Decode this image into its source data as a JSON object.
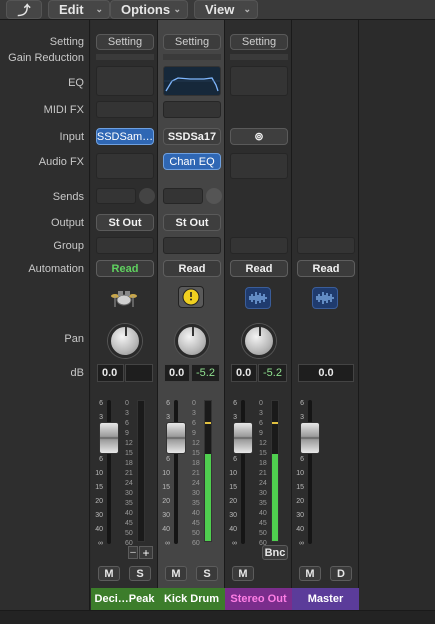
{
  "menubar": {
    "back_glyph": "⤴",
    "menus": [
      "Edit",
      "Options",
      "View"
    ]
  },
  "row_labels": {
    "setting": "Setting",
    "gain_reduction": "Gain Reduction",
    "eq": "EQ",
    "midi_fx": "MIDI FX",
    "input": "Input",
    "audio_fx": "Audio FX",
    "sends": "Sends",
    "output": "Output",
    "group": "Group",
    "automation": "Automation",
    "pan": "Pan",
    "db": "dB"
  },
  "strips": [
    {
      "setting": "Setting",
      "input": "SSDSam…",
      "audio_fx": "",
      "output": "St Out",
      "automation": "Read",
      "automation_color": "#5fd15f",
      "icon": "drum-kit-icon",
      "db_volume": "0.0",
      "db_peak": "",
      "mute": "M",
      "solo": "S",
      "extra": "+",
      "name": "Deci…Peak",
      "name_color": "#3c7d2b",
      "meter_level": 0
    },
    {
      "setting": "Setting",
      "input": "SSDSa17",
      "audio_fx": "Chan EQ",
      "output": "St Out",
      "automation": "Read",
      "automation_color": "#f0f0f0",
      "icon": "clock-icon",
      "db_volume": "0.0",
      "db_peak": "-5.2",
      "mute": "M",
      "solo": "S",
      "name": "Kick Drum",
      "name_color": "#3c7d2b",
      "meter_level": 0.62
    },
    {
      "setting": "Setting",
      "input": "⊚",
      "audio_fx": "",
      "output": "",
      "automation": "Read",
      "automation_color": "#f0f0f0",
      "icon": "waveform-icon",
      "db_volume": "0.0",
      "db_peak": "-5.2",
      "mute": "M",
      "bounce": "Bnc",
      "name": "Stereo Out",
      "name_color": "#7a2d8c",
      "meter_level": 0.62
    },
    {
      "automation": "Read",
      "automation_color": "#f0f0f0",
      "icon": "waveform-icon",
      "db_volume": "0.0",
      "mute": "M",
      "dim": "D",
      "name": "Master",
      "name_color": "#5b3c9a"
    }
  ],
  "fader_scale": [
    "6",
    "3",
    "0",
    "3",
    "6",
    "10",
    "15",
    "20",
    "30",
    "40",
    "∞"
  ],
  "meter_scale": [
    "0",
    "3",
    "6",
    "9",
    "12",
    "15",
    "18",
    "21",
    "24",
    "30",
    "35",
    "40",
    "45",
    "50",
    "60"
  ],
  "colors": {
    "accent_blue": "#2f67b4",
    "meter_green": "#4fcf4f",
    "selected_strip_bg": "#4a4a4a"
  }
}
